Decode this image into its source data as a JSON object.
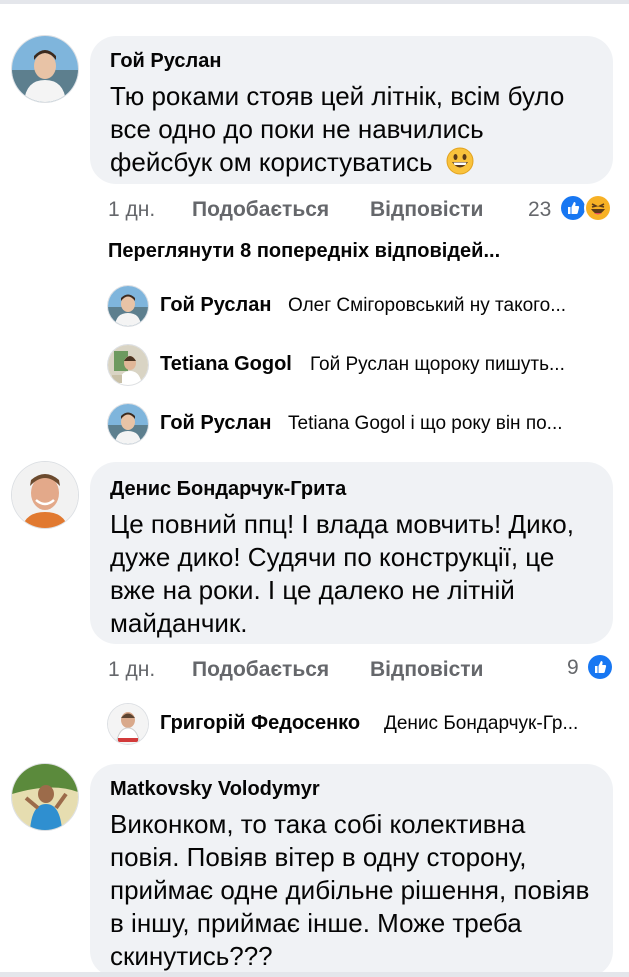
{
  "comments": [
    {
      "author": "Гой Руслан",
      "lines": [
        "Тю роками стояв цей літнік, всім було",
        "все одно до поки не навчились",
        "фейсбук ом користуватись"
      ],
      "emoji": "grinning-face-emoji",
      "time": "1 дн.",
      "like_label": "Подобається",
      "reply_label": "Відповісти",
      "reaction_count": "23",
      "reactions": [
        "like-icon",
        "haha-icon"
      ]
    },
    {
      "author": "Денис Бондарчук-Грита",
      "lines": [
        "Це повний ппц! І влада мовчить! Дико,",
        "дуже дико! Судячи по конструкції, це",
        "вже на роки. І це далеко не літній",
        "майданчик."
      ],
      "time": "1 дн.",
      "like_label": "Подобається",
      "reply_label": "Відповісти",
      "reaction_count": "9",
      "reactions": [
        "like-icon"
      ]
    },
    {
      "author": "Matkovsky Volodymyr",
      "lines": [
        "Виконком, то така собі колективна",
        "повія. Повіяв вітер в одну сторону,",
        "приймає одне дибільне рішення, повіяв",
        "в іншу, приймає інше. Може треба",
        "скинутись???"
      ]
    }
  ],
  "view_previous": "Переглянути 8 попередніх відповідей...",
  "replies": [
    {
      "author": "Гой Руслан",
      "text": "Олег Смігоровський ну такого..."
    },
    {
      "author": "Tetiana Gogol",
      "text": "Гой Руслан щороку пишуть..."
    },
    {
      "author": "Гой Руслан",
      "text": "Tetiana Gogol і що року він по..."
    },
    {
      "author": "Григорій Федосенко",
      "text": "Денис Бондарчук-Гр..."
    }
  ],
  "colors": {
    "bubble": "#f0f2f5",
    "secondary_text": "#65676b",
    "like_blue": "#1877f2",
    "haha_yellow": "#f7b125"
  }
}
